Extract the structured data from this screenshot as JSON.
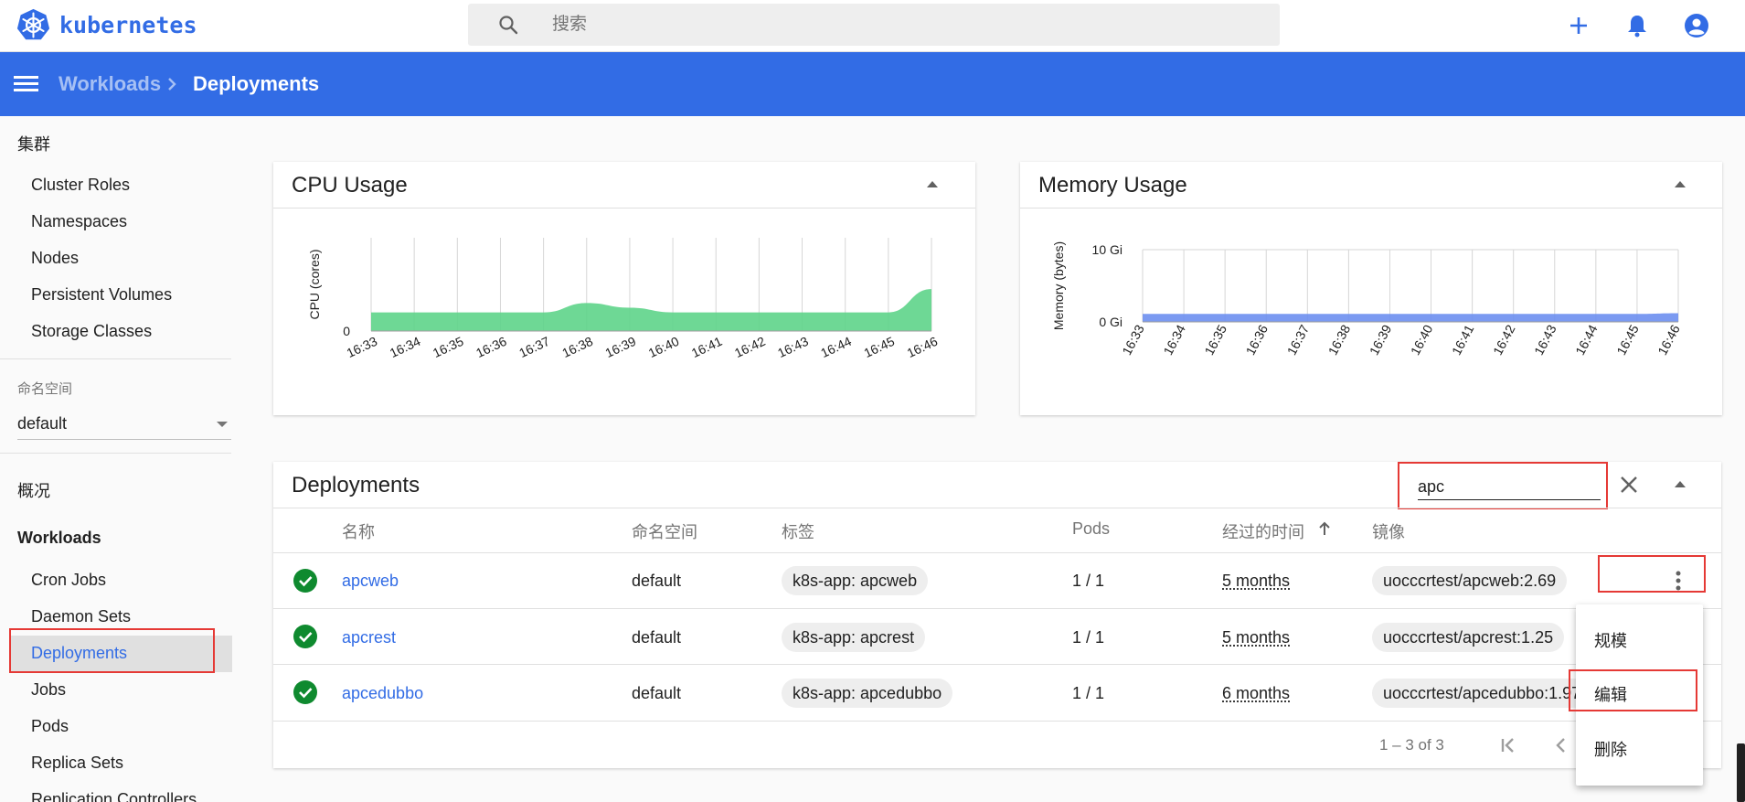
{
  "app": {
    "title": "kubernetes"
  },
  "search": {
    "placeholder": "搜索"
  },
  "breadcrumb": {
    "parent": "Workloads",
    "current": "Deployments"
  },
  "sidebar": {
    "cluster_header": "集群",
    "cluster_items": [
      "Cluster Roles",
      "Namespaces",
      "Nodes",
      "Persistent Volumes",
      "Storage Classes"
    ],
    "namespace_label": "命名空间",
    "namespace_value": "default",
    "overview": "概况",
    "workloads_header": "Workloads",
    "workload_items": [
      "Cron Jobs",
      "Daemon Sets",
      "Deployments",
      "Jobs",
      "Pods",
      "Replica Sets",
      "Replication Controllers"
    ]
  },
  "cpu_card": {
    "title": "CPU Usage"
  },
  "memory_card": {
    "title": "Memory Usage"
  },
  "chart_data": [
    {
      "type": "area",
      "title": "CPU Usage",
      "ylabel": "CPU (cores)",
      "yticks": [
        "0"
      ],
      "x": [
        "16:33",
        "16:34",
        "16:35",
        "16:36",
        "16:37",
        "16:38",
        "16:39",
        "16:40",
        "16:41",
        "16:42",
        "16:43",
        "16:44",
        "16:45",
        "16:46"
      ],
      "values": [
        0.2,
        0.2,
        0.2,
        0.2,
        0.2,
        0.3,
        0.25,
        0.2,
        0.2,
        0.2,
        0.2,
        0.2,
        0.2,
        0.45
      ],
      "ylim": [
        0,
        1
      ],
      "color": "#5ed48a",
      "grid": true
    },
    {
      "type": "area",
      "title": "Memory Usage",
      "ylabel": "Memory (bytes)",
      "yticks": [
        "10 Gi",
        "0 Gi"
      ],
      "x": [
        "16:33",
        "16:34",
        "16:35",
        "16:36",
        "16:37",
        "16:38",
        "16:39",
        "16:40",
        "16:41",
        "16:42",
        "16:43",
        "16:44",
        "16:45",
        "16:46"
      ],
      "values": [
        1.1,
        1.1,
        1.1,
        1.1,
        1.1,
        1.1,
        1.1,
        1.1,
        1.1,
        1.1,
        1.1,
        1.1,
        1.1,
        1.2
      ],
      "ylim": [
        0,
        10
      ],
      "color": "#6d8ff0",
      "grid": true
    }
  ],
  "deployments": {
    "title": "Deployments",
    "filter_value": "apc",
    "columns": [
      "名称",
      "命名空间",
      "标签",
      "Pods",
      "经过的时间",
      "镜像"
    ],
    "rows": [
      {
        "name": "apcweb",
        "namespace": "default",
        "label": "k8s-app: apcweb",
        "pods": "1 / 1",
        "age": "5 months",
        "image": "uocccrtest/apcweb:2.69"
      },
      {
        "name": "apcrest",
        "namespace": "default",
        "label": "k8s-app: apcrest",
        "pods": "1 / 1",
        "age": "5 months",
        "image": "uocccrtest/apcrest:1.25"
      },
      {
        "name": "apcedubbo",
        "namespace": "default",
        "label": "k8s-app: apcedubbo",
        "pods": "1 / 1",
        "age": "6 months",
        "image": "uocccrtest/apcedubbo:1.97"
      }
    ],
    "pager": "1 – 3 of 3"
  },
  "action_menu": {
    "items": [
      "规模",
      "编辑",
      "删除"
    ]
  },
  "colors": {
    "brand": "#326ce5",
    "success": "#0f8a2f",
    "highlight": "#e53935"
  }
}
